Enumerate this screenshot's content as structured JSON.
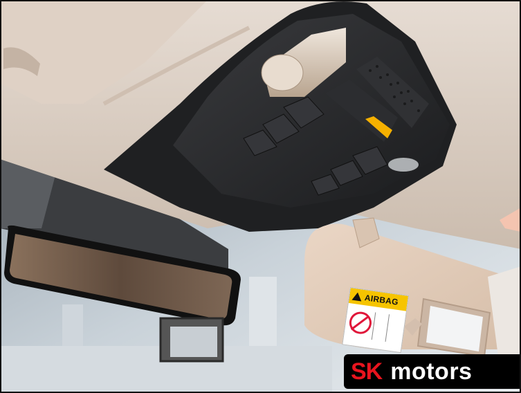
{
  "scene": {
    "subject": "car-interior-overhead-console",
    "colors": {
      "headliner": "#d8cdc2",
      "console": "#2a2b2d",
      "visor": "#e2cdbb",
      "mirror_glass": "#7a6452",
      "windshield": "#b9c4cd",
      "display_amber": "#f5b000"
    }
  },
  "airbag_label": {
    "title": "AIRBAG",
    "icon": "warning-triangle-icon"
  },
  "watermark": {
    "brand_sk": "SK",
    "brand_motors": "motors",
    "brand_color": "#e8141e"
  }
}
